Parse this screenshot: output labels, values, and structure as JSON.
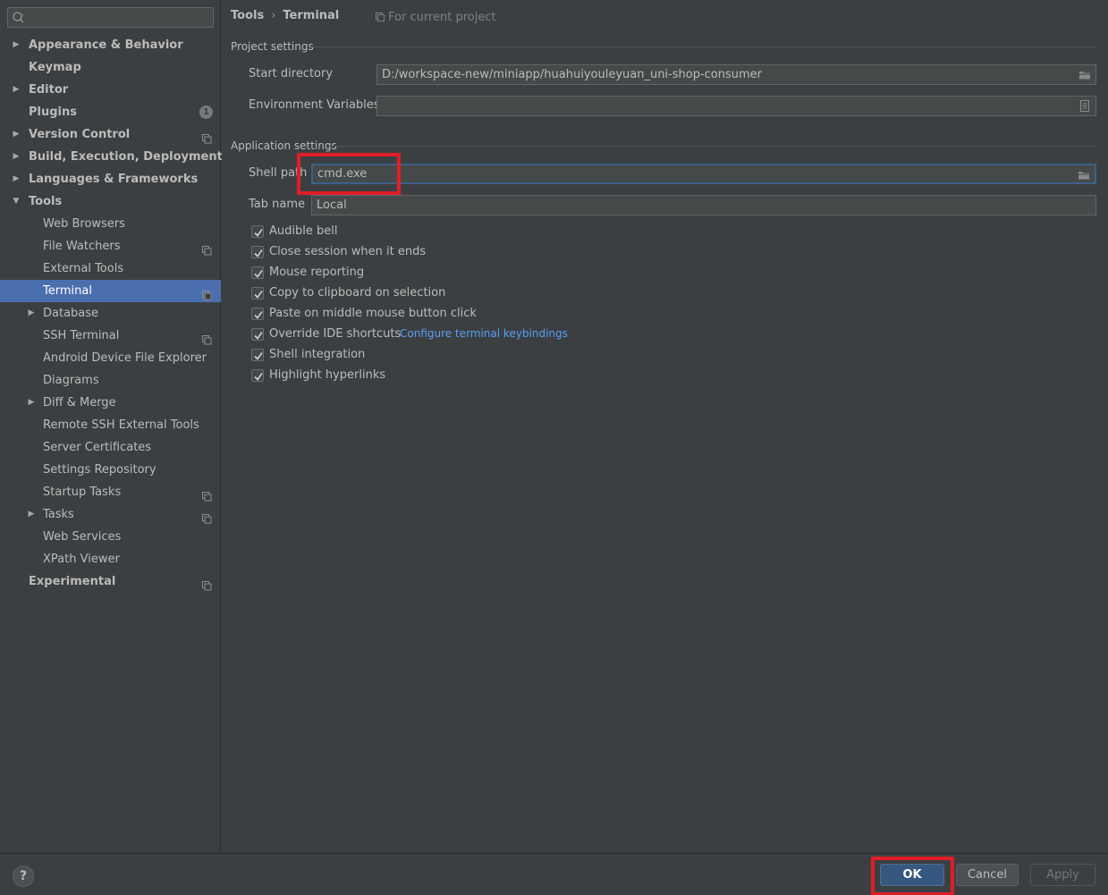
{
  "search": {
    "placeholder": "",
    "value": ""
  },
  "sidebar": {
    "items": [
      {
        "label": "Appearance & Behavior",
        "level": 0,
        "bold": true,
        "arrow": "right"
      },
      {
        "label": "Keymap",
        "level": 0,
        "bold": true,
        "arrow": ""
      },
      {
        "label": "Editor",
        "level": 0,
        "bold": true,
        "arrow": "right"
      },
      {
        "label": "Plugins",
        "level": 0,
        "bold": true,
        "arrow": "",
        "badge": "1"
      },
      {
        "label": "Version Control",
        "level": 0,
        "bold": true,
        "arrow": "right",
        "project": true
      },
      {
        "label": "Build, Execution, Deployment",
        "level": 0,
        "bold": true,
        "arrow": "right"
      },
      {
        "label": "Languages & Frameworks",
        "level": 0,
        "bold": true,
        "arrow": "right"
      },
      {
        "label": "Tools",
        "level": 0,
        "bold": true,
        "arrow": "down"
      },
      {
        "label": "Web Browsers",
        "level": 1,
        "arrow": ""
      },
      {
        "label": "File Watchers",
        "level": 1,
        "arrow": "",
        "project": true
      },
      {
        "label": "External Tools",
        "level": 1,
        "arrow": ""
      },
      {
        "label": "Terminal",
        "level": 1,
        "arrow": "",
        "project": true,
        "selected": true
      },
      {
        "label": "Database",
        "level": 1,
        "arrow": "right"
      },
      {
        "label": "SSH Terminal",
        "level": 1,
        "arrow": "",
        "project": true
      },
      {
        "label": "Android Device File Explorer",
        "level": 1,
        "arrow": ""
      },
      {
        "label": "Diagrams",
        "level": 1,
        "arrow": ""
      },
      {
        "label": "Diff & Merge",
        "level": 1,
        "arrow": "right"
      },
      {
        "label": "Remote SSH External Tools",
        "level": 1,
        "arrow": ""
      },
      {
        "label": "Server Certificates",
        "level": 1,
        "arrow": ""
      },
      {
        "label": "Settings Repository",
        "level": 1,
        "arrow": ""
      },
      {
        "label": "Startup Tasks",
        "level": 1,
        "arrow": "",
        "project": true
      },
      {
        "label": "Tasks",
        "level": 1,
        "arrow": "right",
        "project": true
      },
      {
        "label": "Web Services",
        "level": 1,
        "arrow": ""
      },
      {
        "label": "XPath Viewer",
        "level": 1,
        "arrow": ""
      },
      {
        "label": "Experimental",
        "level": 0,
        "bold": true,
        "arrow": "",
        "project": true
      }
    ]
  },
  "header": {
    "crumb_parent": "Tools",
    "crumb_separator": "›",
    "crumb_current": "Terminal",
    "scope": "For current project"
  },
  "project_settings": {
    "title": "Project settings",
    "start_directory_label": "Start directory",
    "start_directory_value": "D:/workspace-new/miniapp/huahuiyouleyuan_uni-shop-consumer",
    "env_vars_label": "Environment Variables",
    "env_vars_value": ""
  },
  "app_settings": {
    "title": "Application settings",
    "shell_path_label": "Shell path",
    "shell_path_value": "cmd.exe",
    "tab_name_label": "Tab name",
    "tab_name_value": "Local",
    "options": [
      {
        "label": "Audible bell",
        "checked": true
      },
      {
        "label": "Close session when it ends",
        "checked": true
      },
      {
        "label": "Mouse reporting",
        "checked": true
      },
      {
        "label": "Copy to clipboard on selection",
        "checked": true
      },
      {
        "label": "Paste on middle mouse button click",
        "checked": true
      },
      {
        "label": "Override IDE shortcuts",
        "checked": true
      },
      {
        "label": "Shell integration",
        "checked": true
      },
      {
        "label": "Highlight hyperlinks",
        "checked": true
      }
    ],
    "keybindings_link": "Configure terminal keybindings"
  },
  "footer": {
    "help_label": "?",
    "ok_label": "OK",
    "cancel_label": "Cancel",
    "apply_label": "Apply"
  },
  "colors": {
    "background": "#3c3f41",
    "selection": "#4b6eaf",
    "link": "#589df6",
    "highlight": "#e01e27"
  }
}
